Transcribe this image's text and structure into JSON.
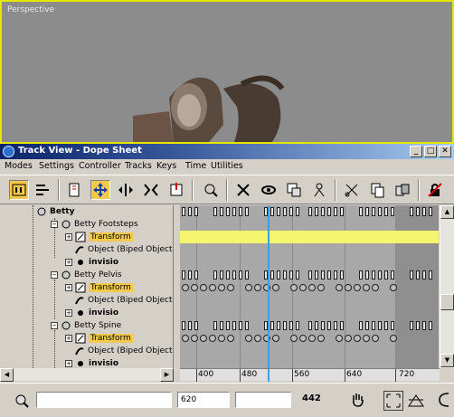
{
  "viewport": {
    "label": "Perspective"
  },
  "window": {
    "title": "Track View - Dope Sheet",
    "controls": {
      "minimize": "_",
      "maximize": "□",
      "close": "✕"
    }
  },
  "menu": [
    "Modes",
    "Settings",
    "Controller",
    "Tracks",
    "Keys",
    "Time",
    "Utilities"
  ],
  "toolbar_icons": [
    "edit-keys-icon",
    "edit-ranges-icon",
    "filter-icon",
    "move-keys-icon",
    "slide-keys-icon",
    "scale-keys-icon",
    "scale-time-icon",
    "select-time-icon",
    "delete-time-icon",
    "reverse-time-icon",
    "insert-time-icon",
    "cut-time-icon",
    "copy-time-icon",
    "paste-time-icon",
    "lock-selection-icon",
    "snap-frames-icon",
    "show-keyable-icon",
    "modify-subtree-icon"
  ],
  "tree": {
    "items": [
      {
        "label": "Betty",
        "bold": true,
        "highlight": false,
        "icon": "object-icon"
      },
      {
        "label": "Betty Footsteps",
        "bold": false,
        "highlight": false,
        "icon": "object-icon"
      },
      {
        "label": "Transform",
        "bold": false,
        "highlight": true,
        "icon": "transform-icon"
      },
      {
        "label": "Object (Biped Object)",
        "bold": false,
        "highlight": false,
        "icon": "modifier-icon"
      },
      {
        "label": "invisio",
        "bold": true,
        "highlight": false,
        "icon": "visibility-icon"
      },
      {
        "label": "Betty Pelvis",
        "bold": false,
        "highlight": false,
        "icon": "object-icon"
      },
      {
        "label": "Transform",
        "bold": false,
        "highlight": true,
        "icon": "transform-icon"
      },
      {
        "label": "Object (Biped Object)",
        "bold": false,
        "highlight": false,
        "icon": "modifier-icon"
      },
      {
        "label": "invisio",
        "bold": true,
        "highlight": false,
        "icon": "visibility-icon"
      },
      {
        "label": "Betty Spine",
        "bold": false,
        "highlight": false,
        "icon": "object-icon"
      },
      {
        "label": "Transform",
        "bold": false,
        "highlight": true,
        "icon": "transform-icon"
      },
      {
        "label": "Object (Biped Object)",
        "bold": false,
        "highlight": false,
        "icon": "modifier-icon"
      },
      {
        "label": "invisio",
        "bold": true,
        "highlight": false,
        "icon": "visibility-icon"
      }
    ]
  },
  "ruler": {
    "labels": [
      "400",
      "480",
      "560",
      "640",
      "720"
    ]
  },
  "status": {
    "frame_field": "620",
    "value_field": "",
    "frame_number": "442"
  },
  "colors": {
    "highlight": "#f2c94c",
    "timeline": "#3aa0e0",
    "track_yellow": "#f5f56e"
  }
}
